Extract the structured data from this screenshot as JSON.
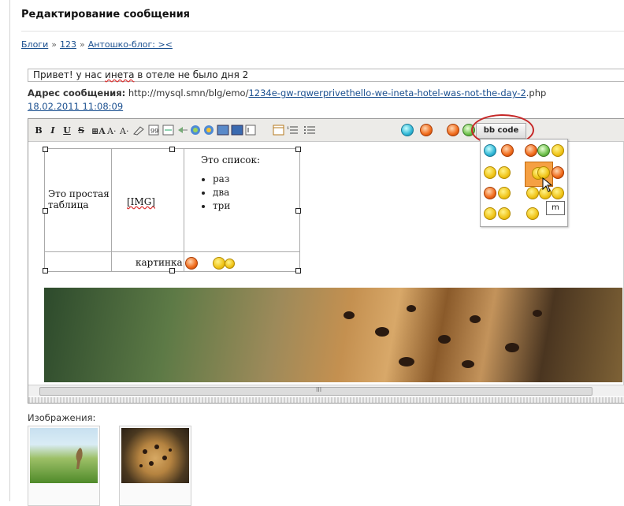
{
  "page": {
    "title": "Редактирование сообщения",
    "breadcrumbs": [
      "Блоги",
      "123",
      "Антошко-блог: ><"
    ],
    "breadcrumb_sep": "»"
  },
  "subject": {
    "before": "Привет! у нас ",
    "typo": "инета",
    "after": " в отеле не было дня 2"
  },
  "address": {
    "label": "Адрес сообщения:",
    "base": "http://mysql.smn/blg/emo/",
    "slug": "1234e-gw-rqwerprivethello-we-ineta-hotel-was-not-the-day-2",
    "ext": ".php"
  },
  "date": "18.02.2011 11:08:09",
  "toolbar": {
    "bold": "B",
    "italic": "I",
    "underline": "U",
    "strike": "S",
    "bbcode_label": "bb code"
  },
  "table": {
    "cell1": "Это простая таблица",
    "cell1_line1": "Это простая",
    "cell1_line2": "таблица",
    "cell2": "[IMG]",
    "list_title": "Это список:",
    "list_items": [
      "раз",
      "два",
      "три"
    ],
    "footer_cell": "картинка"
  },
  "scroll": {
    "hscroll_mark": "III"
  },
  "popup": {
    "tooltip": "m"
  },
  "images_label": "Изображения:",
  "icons": [
    "bold-icon",
    "italic-icon",
    "underline-icon",
    "strike-icon",
    "font-icon",
    "smile-icon",
    "bbcode-icon"
  ],
  "colors": {
    "link": "#1a4f8f",
    "highlight_ring": "#c62828",
    "smile_highlight": "#f5a043"
  }
}
